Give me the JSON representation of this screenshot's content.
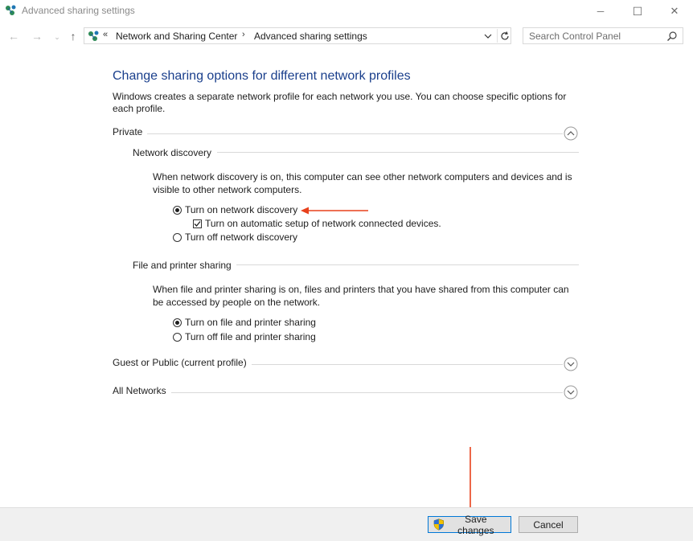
{
  "window": {
    "title": "Advanced sharing settings",
    "minimize_glyph": "─",
    "maximize_glyph": "☐",
    "close_glyph": "✕"
  },
  "nav": {
    "back_glyph": "←",
    "forward_glyph": "→",
    "recent_glyph": "⌄",
    "up_glyph": "↑"
  },
  "address": {
    "overflow_glyph": "«",
    "breadcrumbs": [
      "Network and Sharing Center",
      "Advanced sharing settings"
    ],
    "separator_glyph": "›"
  },
  "search": {
    "placeholder": "Search Control Panel"
  },
  "main": {
    "heading": "Change sharing options for different network profiles",
    "intro": "Windows creates a separate network profile for each network you use. You can choose specific options for each profile.",
    "profiles": [
      {
        "label": "Private",
        "expanded": true,
        "sections": [
          {
            "title": "Network discovery",
            "description": "When network discovery is on, this computer can see other network computers and devices and is visible to other network computers.",
            "options": [
              {
                "label": "Turn on network discovery",
                "selected": true
              },
              {
                "label": "Turn on automatic setup of network connected devices.",
                "checked": true
              },
              {
                "label": "Turn off network discovery",
                "selected": false
              }
            ]
          },
          {
            "title": "File and printer sharing",
            "description": "When file and printer sharing is on, files and printers that you have shared from this computer can be accessed by people on the network.",
            "options": [
              {
                "label": "Turn on file and printer sharing",
                "selected": true
              },
              {
                "label": "Turn off file and printer sharing",
                "selected": false
              }
            ]
          }
        ]
      },
      {
        "label": "Guest or Public (current profile)",
        "expanded": false
      },
      {
        "label": "All Networks",
        "expanded": false
      }
    ]
  },
  "footer": {
    "save_label": "Save changes",
    "cancel_label": "Cancel"
  },
  "colors": {
    "heading": "#1a3f8c",
    "annotation_arrow": "#e8411c",
    "button_focus_border": "#0078d7"
  }
}
